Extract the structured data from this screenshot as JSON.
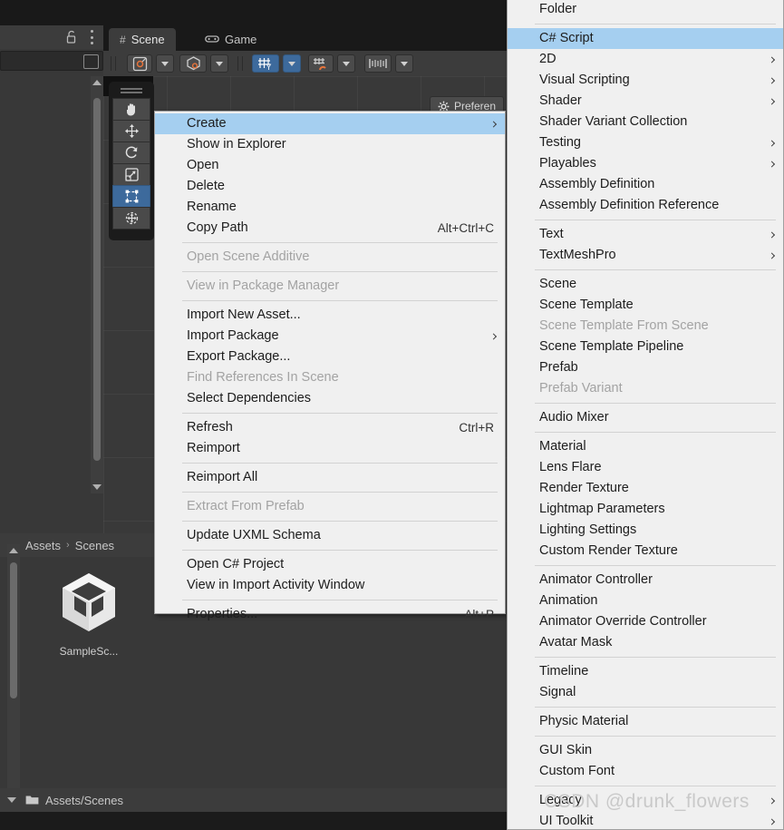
{
  "editor": {
    "tabs": [
      {
        "label": "Scene",
        "icon": "grid-hash-icon",
        "active": true
      },
      {
        "label": "Game",
        "icon": "gamepad-icon",
        "active": false
      }
    ],
    "left_panel": {
      "lock_icon": "lock-icon",
      "kebab_icon": "more-options-icon",
      "search_icon": "search-jump-icon"
    },
    "scene_toolbar": [
      {
        "name": "draw-mode-button",
        "icon": "shaded-mode-icon",
        "active": false,
        "has_caret": true
      },
      {
        "name": "2d-3d-toggle-button",
        "icon": "cube-perspective-icon",
        "active": false,
        "has_caret": true
      },
      {
        "name": "grid-snap-button",
        "icon": "grid-axis-y-icon",
        "active": true,
        "has_caret": true
      },
      {
        "name": "snap-increment-button",
        "icon": "magnet-grid-icon",
        "active": false,
        "has_caret": true
      },
      {
        "name": "scene-visibility-button",
        "icon": "gizmos-ruler-icon",
        "active": false,
        "has_caret": true
      }
    ],
    "tools_overlay": [
      {
        "name": "hand-tool",
        "icon": "hand-icon",
        "selected": false
      },
      {
        "name": "move-tool",
        "icon": "move-arrows-icon",
        "selected": false
      },
      {
        "name": "rotate-tool",
        "icon": "rotate-icon",
        "selected": false
      },
      {
        "name": "scale-tool",
        "icon": "scale-icon",
        "selected": false
      },
      {
        "name": "rect-tool",
        "icon": "rect-transform-icon",
        "selected": true
      },
      {
        "name": "transform-tool",
        "icon": "transform-tool-icon",
        "selected": false
      }
    ],
    "preferences_button": {
      "label": "Preferen",
      "icon": "gear-icon"
    },
    "project": {
      "breadcrumbs": [
        "Assets",
        "Scenes"
      ],
      "breadcrumb_separator": "›",
      "assets": [
        {
          "label": "SampleSc...",
          "icon": "unity-scene-icon"
        }
      ],
      "status_path": "Assets/Scenes",
      "status_icon": "folder-icon"
    },
    "watermark": "CSDN @drunk_flowers"
  },
  "context_menu": {
    "items": [
      {
        "label": "Create",
        "shortcut": "",
        "submenu": true,
        "disabled": false,
        "highlighted": true
      },
      {
        "label": "Show in Explorer",
        "shortcut": "",
        "submenu": false,
        "disabled": false
      },
      {
        "label": "Open",
        "shortcut": "",
        "submenu": false,
        "disabled": false
      },
      {
        "label": "Delete",
        "shortcut": "",
        "submenu": false,
        "disabled": false
      },
      {
        "label": "Rename",
        "shortcut": "",
        "submenu": false,
        "disabled": false
      },
      {
        "label": "Copy Path",
        "shortcut": "Alt+Ctrl+C",
        "submenu": false,
        "disabled": false
      },
      {
        "separator": true
      },
      {
        "label": "Open Scene Additive",
        "shortcut": "",
        "submenu": false,
        "disabled": true
      },
      {
        "separator": true
      },
      {
        "label": "View in Package Manager",
        "shortcut": "",
        "submenu": false,
        "disabled": true
      },
      {
        "separator": true
      },
      {
        "label": "Import New Asset...",
        "shortcut": "",
        "submenu": false,
        "disabled": false
      },
      {
        "label": "Import Package",
        "shortcut": "",
        "submenu": true,
        "disabled": false
      },
      {
        "label": "Export Package...",
        "shortcut": "",
        "submenu": false,
        "disabled": false
      },
      {
        "label": "Find References In Scene",
        "shortcut": "",
        "submenu": false,
        "disabled": true
      },
      {
        "label": "Select Dependencies",
        "shortcut": "",
        "submenu": false,
        "disabled": false
      },
      {
        "separator": true
      },
      {
        "label": "Refresh",
        "shortcut": "Ctrl+R",
        "submenu": false,
        "disabled": false
      },
      {
        "label": "Reimport",
        "shortcut": "",
        "submenu": false,
        "disabled": false
      },
      {
        "separator": true
      },
      {
        "label": "Reimport All",
        "shortcut": "",
        "submenu": false,
        "disabled": false
      },
      {
        "separator": true
      },
      {
        "label": "Extract From Prefab",
        "shortcut": "",
        "submenu": false,
        "disabled": true
      },
      {
        "separator": true
      },
      {
        "label": "Update UXML Schema",
        "shortcut": "",
        "submenu": false,
        "disabled": false
      },
      {
        "separator": true
      },
      {
        "label": "Open C# Project",
        "shortcut": "",
        "submenu": false,
        "disabled": false
      },
      {
        "label": "View in Import Activity Window",
        "shortcut": "",
        "submenu": false,
        "disabled": false
      },
      {
        "separator": true
      },
      {
        "label": "Properties...",
        "shortcut": "Alt+P",
        "submenu": false,
        "disabled": false
      }
    ]
  },
  "create_submenu": {
    "items": [
      {
        "label": "Folder",
        "submenu": false,
        "disabled": false
      },
      {
        "separator": true
      },
      {
        "label": "C# Script",
        "submenu": false,
        "disabled": false,
        "highlighted": true
      },
      {
        "label": "2D",
        "submenu": true,
        "disabled": false
      },
      {
        "label": "Visual Scripting",
        "submenu": true,
        "disabled": false
      },
      {
        "label": "Shader",
        "submenu": true,
        "disabled": false
      },
      {
        "label": "Shader Variant Collection",
        "submenu": false,
        "disabled": false
      },
      {
        "label": "Testing",
        "submenu": true,
        "disabled": false
      },
      {
        "label": "Playables",
        "submenu": true,
        "disabled": false
      },
      {
        "label": "Assembly Definition",
        "submenu": false,
        "disabled": false
      },
      {
        "label": "Assembly Definition Reference",
        "submenu": false,
        "disabled": false
      },
      {
        "separator": true
      },
      {
        "label": "Text",
        "submenu": true,
        "disabled": false
      },
      {
        "label": "TextMeshPro",
        "submenu": true,
        "disabled": false
      },
      {
        "separator": true
      },
      {
        "label": "Scene",
        "submenu": false,
        "disabled": false
      },
      {
        "label": "Scene Template",
        "submenu": false,
        "disabled": false
      },
      {
        "label": "Scene Template From Scene",
        "submenu": false,
        "disabled": true
      },
      {
        "label": "Scene Template Pipeline",
        "submenu": false,
        "disabled": false
      },
      {
        "label": "Prefab",
        "submenu": false,
        "disabled": false
      },
      {
        "label": "Prefab Variant",
        "submenu": false,
        "disabled": true
      },
      {
        "separator": true
      },
      {
        "label": "Audio Mixer",
        "submenu": false,
        "disabled": false
      },
      {
        "separator": true
      },
      {
        "label": "Material",
        "submenu": false,
        "disabled": false
      },
      {
        "label": "Lens Flare",
        "submenu": false,
        "disabled": false
      },
      {
        "label": "Render Texture",
        "submenu": false,
        "disabled": false
      },
      {
        "label": "Lightmap Parameters",
        "submenu": false,
        "disabled": false
      },
      {
        "label": "Lighting Settings",
        "submenu": false,
        "disabled": false
      },
      {
        "label": "Custom Render Texture",
        "submenu": false,
        "disabled": false
      },
      {
        "separator": true
      },
      {
        "label": "Animator Controller",
        "submenu": false,
        "disabled": false
      },
      {
        "label": "Animation",
        "submenu": false,
        "disabled": false
      },
      {
        "label": "Animator Override Controller",
        "submenu": false,
        "disabled": false
      },
      {
        "label": "Avatar Mask",
        "submenu": false,
        "disabled": false
      },
      {
        "separator": true
      },
      {
        "label": "Timeline",
        "submenu": false,
        "disabled": false
      },
      {
        "label": "Signal",
        "submenu": false,
        "disabled": false
      },
      {
        "separator": true
      },
      {
        "label": "Physic Material",
        "submenu": false,
        "disabled": false
      },
      {
        "separator": true
      },
      {
        "label": "GUI Skin",
        "submenu": false,
        "disabled": false
      },
      {
        "label": "Custom Font",
        "submenu": false,
        "disabled": false
      },
      {
        "separator": true
      },
      {
        "label": "Legacy",
        "submenu": true,
        "disabled": false
      },
      {
        "label": "UI Toolkit",
        "submenu": true,
        "disabled": false
      }
    ]
  },
  "colors": {
    "menu_bg": "#f0f0f0",
    "menu_highlight": "#a5cff0",
    "editor_panel": "#383838",
    "editor_dark": "#191919",
    "accent_blue": "#3d6a9c",
    "accent_orange": "#e8743b"
  }
}
